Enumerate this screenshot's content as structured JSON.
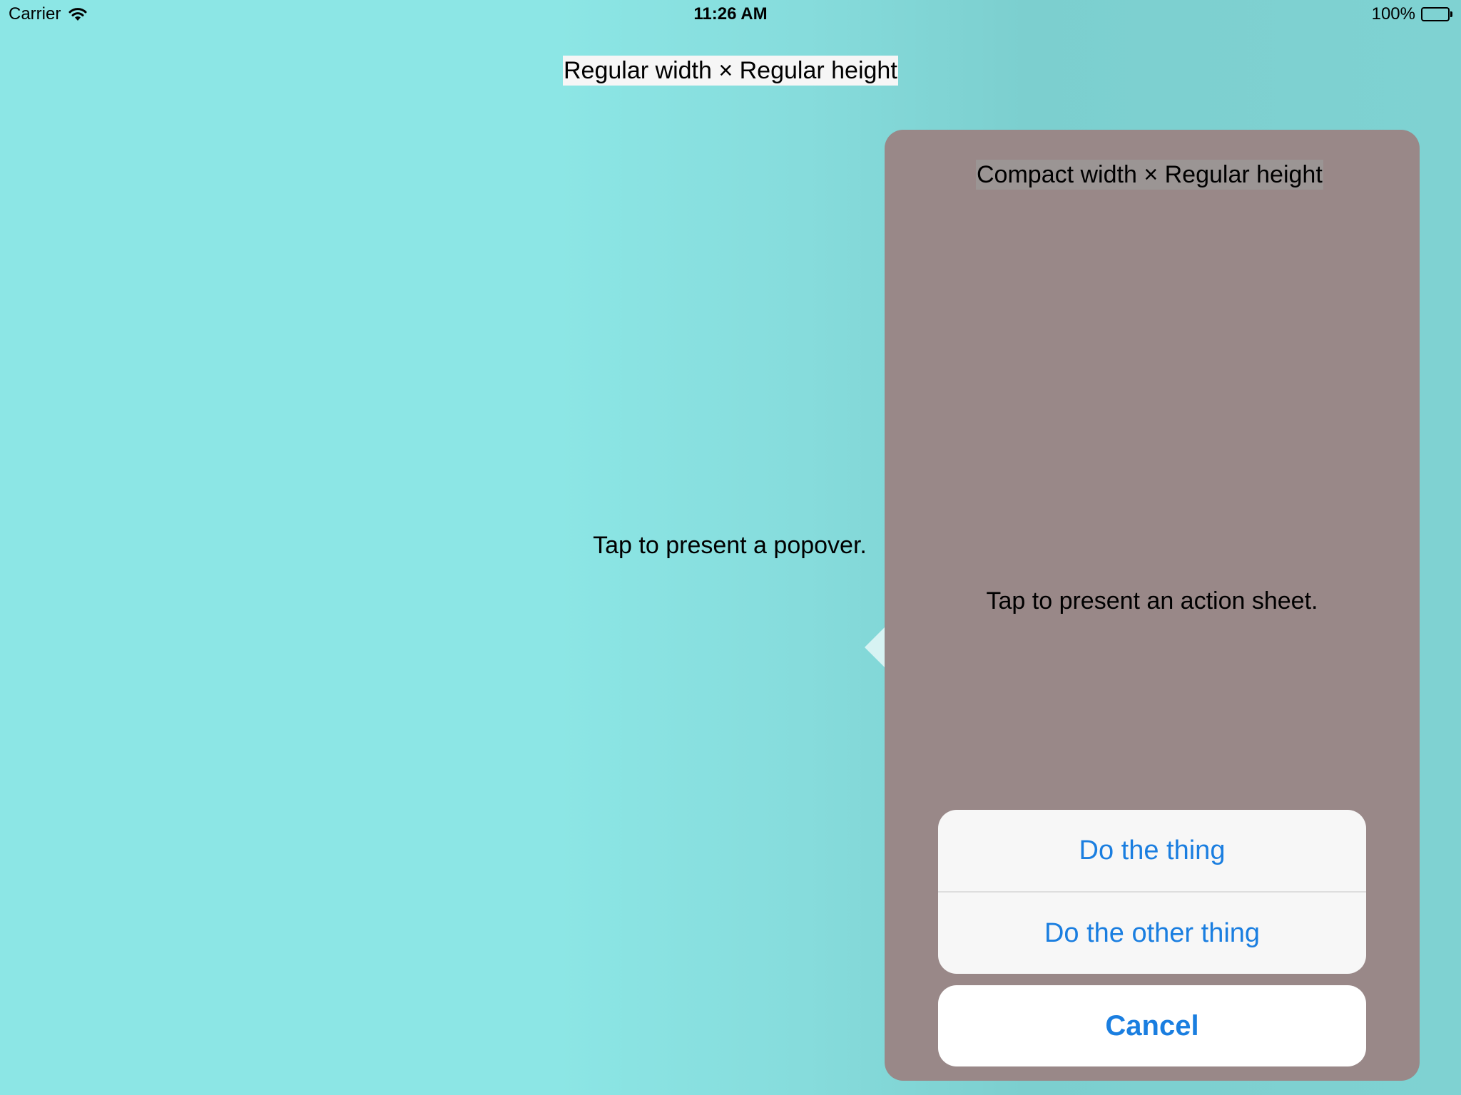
{
  "status_bar": {
    "carrier": "Carrier",
    "wifi_icon": "wifi-icon",
    "time": "11:26 AM",
    "battery_percent": "100%",
    "battery_level": 1.0
  },
  "main": {
    "size_class": "Regular width × Regular height",
    "hint": "Tap to present a popover."
  },
  "popover": {
    "size_class": "Compact width × Regular height",
    "hint": "Tap to present an action sheet.",
    "background_color": "#998888"
  },
  "action_sheet": {
    "actions": [
      {
        "label": "Do the thing"
      },
      {
        "label": "Do the other thing"
      }
    ],
    "cancel_label": "Cancel",
    "accent_color": "#1a7ee0"
  },
  "colors": {
    "background": "#8ce6e5"
  }
}
